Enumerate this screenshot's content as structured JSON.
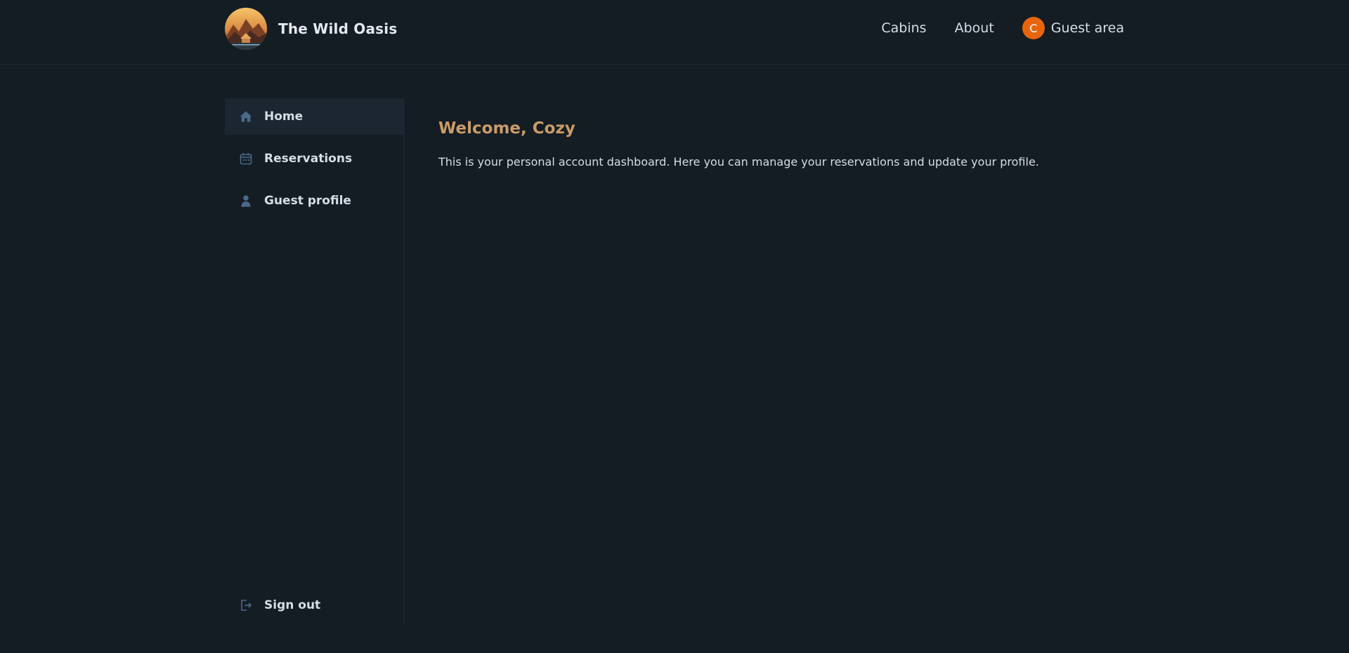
{
  "header": {
    "brand": "The Wild Oasis",
    "nav": [
      {
        "label": "Cabins"
      },
      {
        "label": "About"
      },
      {
        "label": "Guest area",
        "avatar_initial": "C"
      }
    ]
  },
  "sidebar": {
    "items": [
      {
        "label": "Home",
        "icon": "home-icon",
        "active": true
      },
      {
        "label": "Reservations",
        "icon": "calendar-icon"
      },
      {
        "label": "Guest profile",
        "icon": "user-icon"
      }
    ],
    "signout": {
      "label": "Sign out",
      "icon": "sign-out-icon"
    }
  },
  "main": {
    "welcome": "Welcome, Cozy",
    "intro": "This is your personal account dashboard. Here you can manage your reservations and update your profile."
  },
  "colors": {
    "background": "#141c24",
    "accent": "#c99c68",
    "avatar": "#e8650e",
    "icon": "#4a6a8a",
    "active_bg": "#1b2631"
  }
}
